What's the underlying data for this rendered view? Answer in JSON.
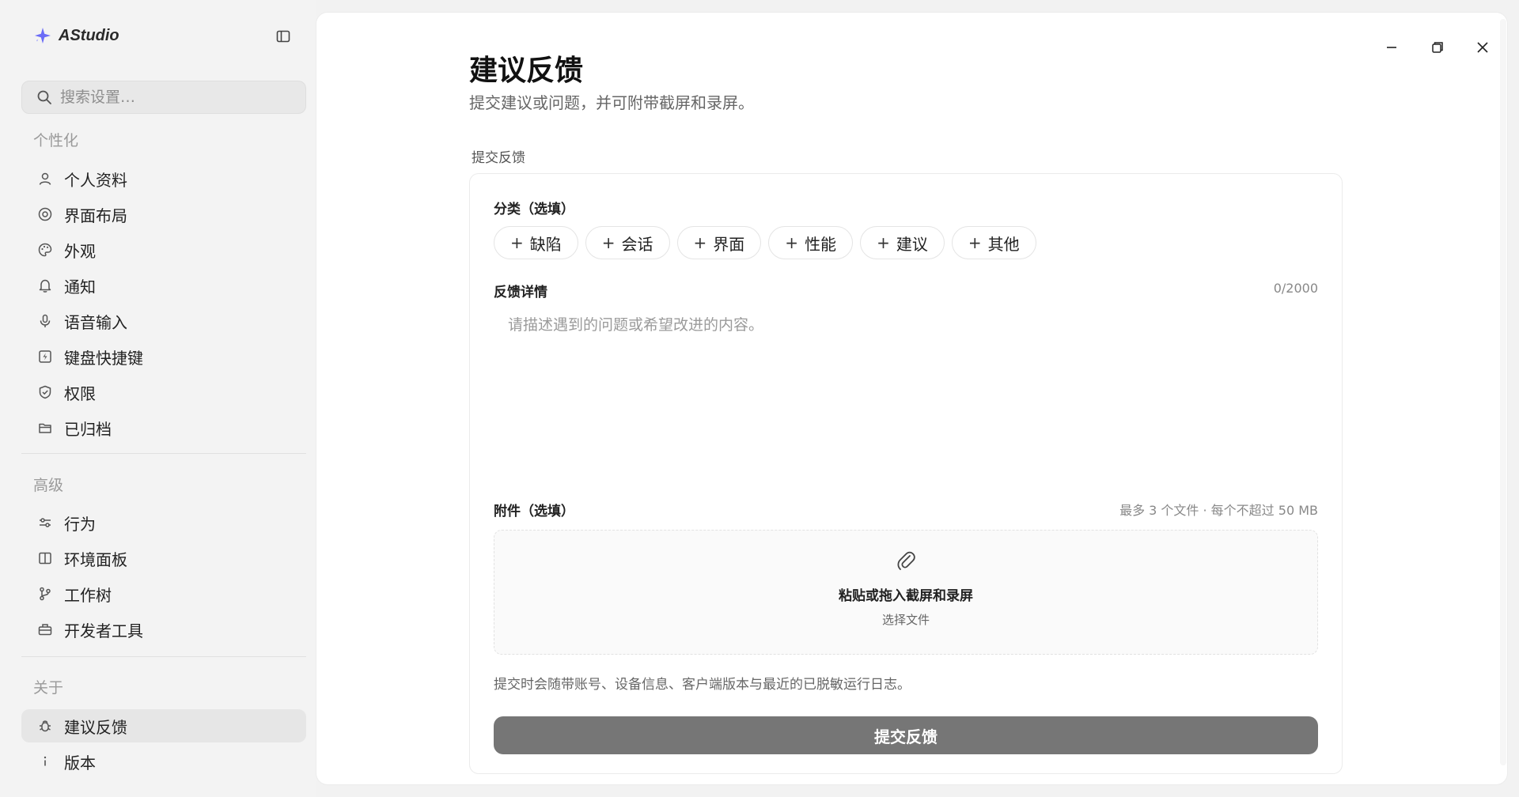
{
  "app": {
    "name": "AStudio"
  },
  "search": {
    "placeholder": "搜索设置…"
  },
  "sidebar": {
    "sections": [
      {
        "label": "个性化"
      },
      {
        "label": "高级"
      },
      {
        "label": "关于"
      }
    ],
    "items": [
      {
        "label": "个人资料",
        "icon": "user-icon"
      },
      {
        "label": "界面布局",
        "icon": "target-icon"
      },
      {
        "label": "外观",
        "icon": "palette-icon"
      },
      {
        "label": "通知",
        "icon": "bell-icon"
      },
      {
        "label": "语音输入",
        "icon": "microphone-icon"
      },
      {
        "label": "键盘快捷键",
        "icon": "keyboard-shortcut-icon"
      },
      {
        "label": "权限",
        "icon": "shield-icon"
      },
      {
        "label": "已归档",
        "icon": "archive-icon"
      },
      {
        "label": "行为",
        "icon": "sliders-icon"
      },
      {
        "label": "环境面板",
        "icon": "panel-icon"
      },
      {
        "label": "工作树",
        "icon": "branch-icon"
      },
      {
        "label": "开发者工具",
        "icon": "toolbox-icon"
      },
      {
        "label": "建议反馈",
        "icon": "bug-icon",
        "active": true
      },
      {
        "label": "版本",
        "icon": "info-icon"
      }
    ]
  },
  "page": {
    "title": "建议反馈",
    "subtitle": "提交建议或问题，并可附带截屏和录屏。",
    "group_label": "提交反馈"
  },
  "form": {
    "category_label": "分类（选填）",
    "categories": [
      "缺陷",
      "会话",
      "界面",
      "性能",
      "建议",
      "其他"
    ],
    "details_label": "反馈详情",
    "details_counter": "0/2000",
    "details_value": "",
    "details_placeholder": "请描述遇到的问题或希望改进的内容。",
    "attachments_label": "附件（选填）",
    "attachments_hint": "最多 3 个文件 · 每个不超过 50 MB",
    "dropzone_title": "粘贴或拖入截屏和录屏",
    "dropzone_link": "选择文件",
    "notice": "提交时会随带账号、设备信息、客户端版本与最近的已脱敏运行日志。",
    "submit_label": "提交反馈"
  },
  "colors": {
    "accent": "#6b6cf7",
    "submit_bg": "#767676",
    "sidebar_bg": "#f3f3f3",
    "active_item_bg": "#e6e6e6"
  }
}
